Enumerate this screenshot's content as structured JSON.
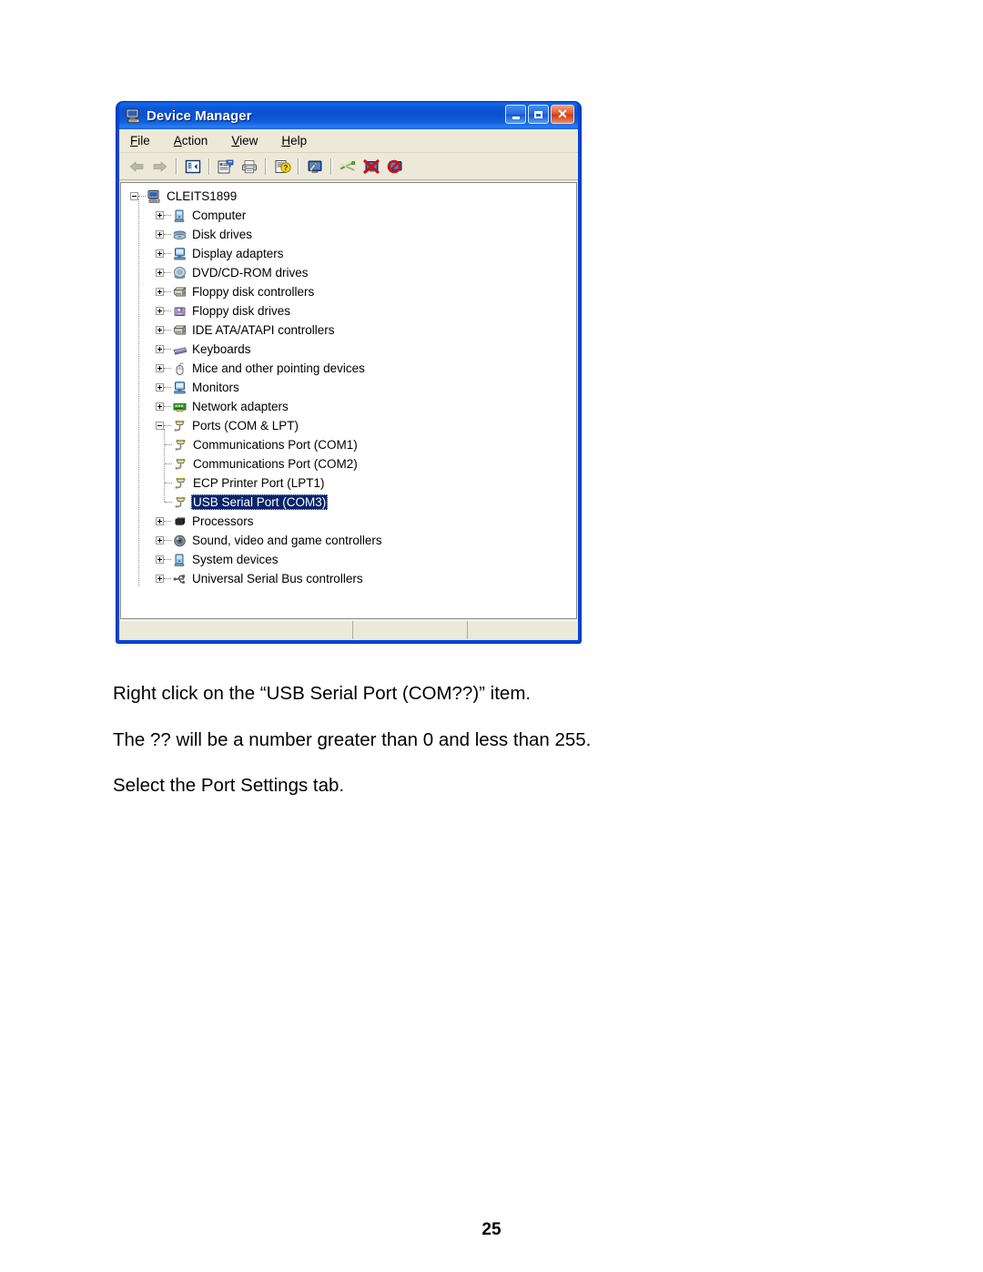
{
  "window": {
    "title": "Device Manager",
    "title_icon": "computer-icon",
    "caption_buttons": [
      {
        "name": "minimize",
        "glyph": "_"
      },
      {
        "name": "maximize",
        "glyph": "□"
      },
      {
        "name": "close",
        "glyph": "✕"
      }
    ]
  },
  "menu": [
    {
      "name": "file",
      "pre": "",
      "acc": "F",
      "post": "ile"
    },
    {
      "name": "action",
      "pre": "",
      "acc": "A",
      "post": "ction"
    },
    {
      "name": "view",
      "pre": "",
      "acc": "V",
      "post": "iew"
    },
    {
      "name": "help",
      "pre": "",
      "acc": "H",
      "post": "elp"
    }
  ],
  "toolbar": [
    {
      "name": "back-icon",
      "label": "Back"
    },
    {
      "name": "forward-icon",
      "label": "Forward"
    },
    {
      "sep": true
    },
    {
      "name": "show-hide-tree-icon",
      "label": "Show/Hide Console Tree"
    },
    {
      "sep": true
    },
    {
      "name": "properties-icon",
      "label": "Properties"
    },
    {
      "name": "print-icon",
      "label": "Print"
    },
    {
      "sep": true
    },
    {
      "name": "help-icon",
      "label": "Help"
    },
    {
      "sep": true
    },
    {
      "name": "scan-hardware-changes-icon",
      "label": "Scan for hardware changes"
    },
    {
      "sep": true
    },
    {
      "name": "unplug-eject-icon",
      "label": "Unplug/Eject"
    },
    {
      "name": "disable-device-icon",
      "label": "Disable"
    },
    {
      "name": "uninstall-device-icon",
      "label": "Uninstall"
    }
  ],
  "tree": {
    "root": {
      "label": "CLEITS1899",
      "icon": "computer-root-icon",
      "state": "expanded"
    },
    "nodes": [
      {
        "label": "Computer",
        "icon": "computer-icon",
        "state": "collapsed",
        "level": 1
      },
      {
        "label": "Disk drives",
        "icon": "disk-drive-icon",
        "state": "collapsed",
        "level": 1
      },
      {
        "label": "Display adapters",
        "icon": "display-adapter-icon",
        "state": "collapsed",
        "level": 1
      },
      {
        "label": "DVD/CD-ROM drives",
        "icon": "cdrom-icon",
        "state": "collapsed",
        "level": 1
      },
      {
        "label": "Floppy disk controllers",
        "icon": "controller-icon",
        "state": "collapsed",
        "level": 1
      },
      {
        "label": "Floppy disk drives",
        "icon": "floppy-drive-icon",
        "state": "collapsed",
        "level": 1
      },
      {
        "label": "IDE ATA/ATAPI controllers",
        "icon": "ide-controller-icon",
        "state": "collapsed",
        "level": 1
      },
      {
        "label": "Keyboards",
        "icon": "keyboard-icon",
        "state": "collapsed",
        "level": 1
      },
      {
        "label": "Mice and other pointing devices",
        "icon": "mouse-icon",
        "state": "collapsed",
        "level": 1
      },
      {
        "label": "Monitors",
        "icon": "monitor-icon",
        "state": "collapsed",
        "level": 1
      },
      {
        "label": "Network adapters",
        "icon": "network-adapter-icon",
        "state": "collapsed",
        "level": 1
      },
      {
        "label": "Ports (COM & LPT)",
        "icon": "port-icon",
        "state": "expanded",
        "level": 1
      },
      {
        "label": "Communications Port (COM1)",
        "icon": "port-icon",
        "state": "leaf",
        "level": 2
      },
      {
        "label": "Communications Port (COM2)",
        "icon": "port-icon",
        "state": "leaf",
        "level": 2
      },
      {
        "label": "ECP Printer Port (LPT1)",
        "icon": "port-icon",
        "state": "leaf",
        "level": 2
      },
      {
        "label": "USB Serial Port (COM3)",
        "icon": "port-icon",
        "state": "leaf",
        "level": 2,
        "selected": true
      },
      {
        "label": "Processors",
        "icon": "processor-icon",
        "state": "collapsed",
        "level": 1
      },
      {
        "label": "Sound, video and game controllers",
        "icon": "sound-icon",
        "state": "collapsed",
        "level": 1
      },
      {
        "label": "System devices",
        "icon": "system-device-icon",
        "state": "collapsed",
        "level": 1
      },
      {
        "label": "Universal Serial Bus controllers",
        "icon": "usb-icon",
        "state": "collapsed",
        "level": 1
      }
    ],
    "selected_label": "USB Serial Port (COM3)"
  },
  "statusbar": {
    "pane1": "",
    "pane2": "",
    "pane3": ""
  },
  "document": {
    "paragraphs": [
      "Right click on the “USB Serial Port (COM??)” item.",
      "The ?? will be a number greater than 0 and less than 255.",
      "Select the Port Settings tab."
    ],
    "page_number": "25"
  },
  "colors": {
    "titlebar_blue": "#0a51d2",
    "window_frame": "#0046d5",
    "client_face": "#ece9d8",
    "selection_blue": "#0a246a",
    "close_button_red": "#d2400f"
  }
}
